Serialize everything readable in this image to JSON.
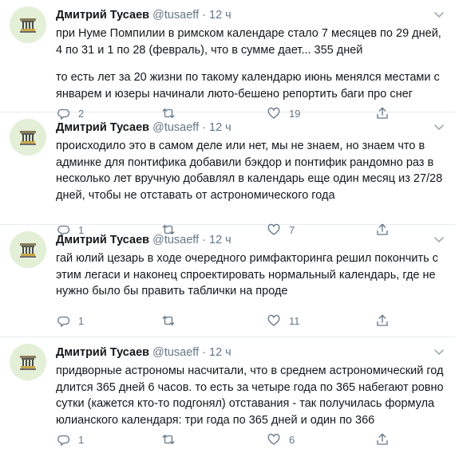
{
  "tweets": [
    {
      "name": "Дмитрий Тусаев",
      "handle": "@tusaeff",
      "separator": "·",
      "time": "12 ч",
      "paragraphs": [
        "при Нуме Помпилии в римском календаре стало 7 месяцев по 29 дней, 4 по 31 и 1 по 28 (февраль), что в сумме дает... 355 дней",
        "то есть лет за 20 жизни по такому календарю июнь менялся местами с январем и юзеры начинали люто-бешено репортить баги про снег"
      ],
      "replies": "2",
      "retweets": "",
      "likes": "19"
    },
    {
      "name": "Дмитрий Тусаев",
      "handle": "@tusaeff",
      "separator": "·",
      "time": "12 ч",
      "paragraphs": [
        "происходило это в самом деле или нет, мы не знаем, но знаем что в админке для понтифика добавили бэкдор и понтифик рандомно раз в несколько лет вручную добавлял в календарь еще один месяц из 27/28 дней, чтобы не отставать от астрономического года"
      ],
      "replies": "1",
      "retweets": "",
      "likes": "7"
    },
    {
      "name": "Дмитрий Тусаев",
      "handle": "@tusaeff",
      "separator": "·",
      "time": "12 ч",
      "paragraphs": [
        "гай юлий цезарь в ходе очередного римфакторинга решил покончить с этим легаси и наконец спроектировать нормальный календарь, где не нужно было бы править таблички на проде"
      ],
      "replies": "1",
      "retweets": "",
      "likes": "11"
    },
    {
      "name": "Дмитрий Тусаев",
      "handle": "@tusaeff",
      "separator": "·",
      "time": "12 ч",
      "paragraphs": [
        "придворные астрономы насчитали, что в среднем астрономический год длится 365 дней 6 часов. то есть за четыре года по 365 набегают ровно сутки (кажется кто-то подгонял) отставания - так получилась формула юлианского календаря: три года по 365 дней и один по 366"
      ],
      "replies": "1",
      "retweets": "",
      "likes": "6"
    }
  ]
}
